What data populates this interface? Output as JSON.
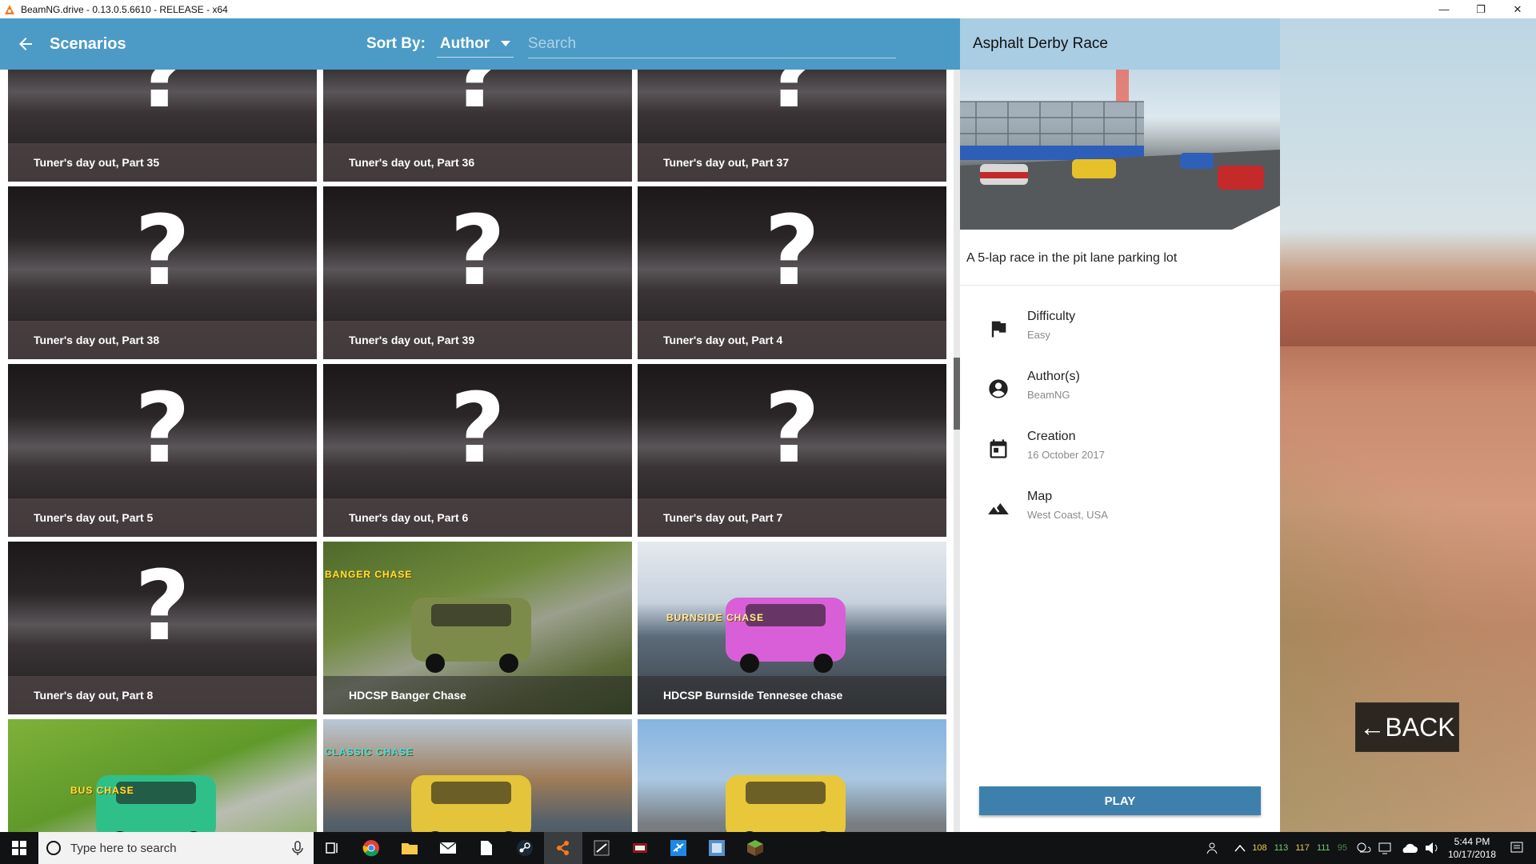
{
  "window": {
    "title": "BeamNG.drive - 0.13.0.5.6610 - RELEASE - x64",
    "minimize": "—",
    "maximize": "❐",
    "close": "✕"
  },
  "topbar": {
    "title": "Scenarios",
    "sort_label": "Sort By:",
    "sort_value": "Author",
    "search_placeholder": "Search"
  },
  "grid": {
    "cards": [
      {
        "label": "Tuner's day out, Part 35",
        "thumb": "?"
      },
      {
        "label": "Tuner's day out, Part 36",
        "thumb": "?"
      },
      {
        "label": "Tuner's day out, Part 37",
        "thumb": "?"
      },
      {
        "label": "Tuner's day out, Part 38",
        "thumb": "?"
      },
      {
        "label": "Tuner's day out, Part 39",
        "thumb": "?"
      },
      {
        "label": "Tuner's day out, Part 4",
        "thumb": "?"
      },
      {
        "label": "Tuner's day out, Part 5",
        "thumb": "?"
      },
      {
        "label": "Tuner's day out, Part 6",
        "thumb": "?"
      },
      {
        "label": "Tuner's day out, Part 7",
        "thumb": "?"
      },
      {
        "label": "Tuner's day out, Part 8",
        "thumb": "?"
      },
      {
        "label": "HDCSP Banger Chase",
        "badge": "BANGER CHASE"
      },
      {
        "label": "HDCSP Burnside Tennesee chase",
        "badge": "BURNSIDE CHASE"
      },
      {
        "label": "",
        "badge": "BUS CHASE"
      },
      {
        "label": "",
        "badge": "CLASSIC CHASE"
      },
      {
        "label": "",
        "badge": ""
      }
    ]
  },
  "details": {
    "title": "Asphalt Derby Race",
    "description": "A 5-lap race in the pit lane parking lot",
    "info": [
      {
        "icon": "flag-icon",
        "label": "Difficulty",
        "value": "Easy"
      },
      {
        "icon": "account-circle-icon",
        "label": "Author(s)",
        "value": "BeamNG"
      },
      {
        "icon": "calendar-icon",
        "label": "Creation",
        "value": "16 October 2017"
      },
      {
        "icon": "terrain-icon",
        "label": "Map",
        "value": "West Coast, USA"
      }
    ],
    "play_label": "PLAY"
  },
  "back_button": "←BACK",
  "taskbar": {
    "search_text": "Type here to search",
    "tray_numbers": [
      "108",
      "113",
      "117",
      "111",
      "95"
    ],
    "time": "5:44 PM",
    "date": "10/17/2018"
  },
  "colors": {
    "accent": "#4c9bc6",
    "details_header": "#a9cde3",
    "play_button": "#3d80ab",
    "tray_yellow": "#e8d24a",
    "tray_green": "#6fd36f"
  }
}
